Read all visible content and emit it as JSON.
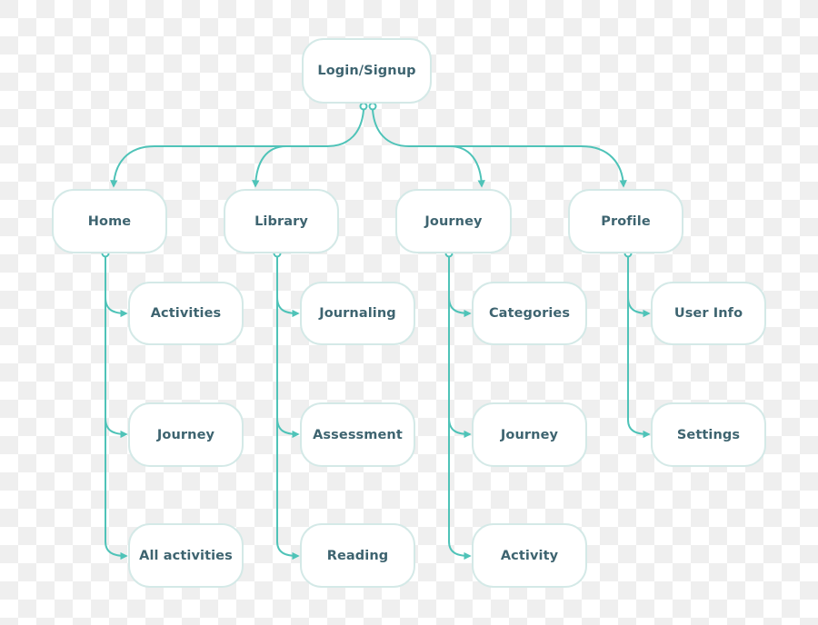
{
  "diagram": {
    "type": "sitemap",
    "colors": {
      "connector": "#4fc3b8",
      "node_border": "#d4e9e7",
      "node_fill": "#ffffff",
      "text": "#3e6470"
    },
    "root": {
      "id": "login",
      "label": "Login/Signup"
    },
    "sections": [
      {
        "id": "home",
        "label": "Home",
        "children": [
          {
            "id": "home-activities",
            "label": "Activities"
          },
          {
            "id": "home-journey",
            "label": "Journey"
          },
          {
            "id": "home-all-activities",
            "label": "All activities"
          }
        ]
      },
      {
        "id": "library",
        "label": "Library",
        "children": [
          {
            "id": "library-journaling",
            "label": "Journaling"
          },
          {
            "id": "library-assessment",
            "label": "Assessment"
          },
          {
            "id": "library-reading",
            "label": "Reading"
          }
        ]
      },
      {
        "id": "journey",
        "label": "Journey",
        "children": [
          {
            "id": "journey-categories",
            "label": "Categories"
          },
          {
            "id": "journey-journey",
            "label": "Journey"
          },
          {
            "id": "journey-activity",
            "label": "Activity"
          }
        ]
      },
      {
        "id": "profile",
        "label": "Profile",
        "children": [
          {
            "id": "profile-user-info",
            "label": "User Info"
          },
          {
            "id": "profile-settings",
            "label": "Settings"
          }
        ]
      }
    ],
    "edges": [
      [
        "login",
        "home"
      ],
      [
        "login",
        "library"
      ],
      [
        "login",
        "journey"
      ],
      [
        "login",
        "profile"
      ],
      [
        "home",
        "home-activities"
      ],
      [
        "home",
        "home-journey"
      ],
      [
        "home",
        "home-all-activities"
      ],
      [
        "library",
        "library-journaling"
      ],
      [
        "library",
        "library-assessment"
      ],
      [
        "library",
        "library-reading"
      ],
      [
        "journey",
        "journey-categories"
      ],
      [
        "journey",
        "journey-journey"
      ],
      [
        "journey",
        "journey-activity"
      ],
      [
        "profile",
        "profile-user-info"
      ],
      [
        "profile",
        "profile-settings"
      ]
    ]
  }
}
